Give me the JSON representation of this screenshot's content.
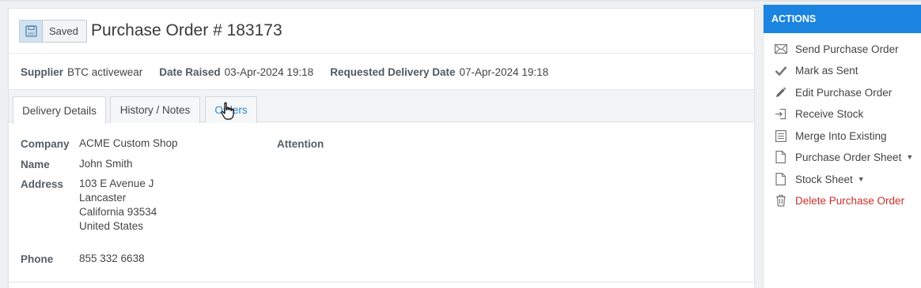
{
  "header": {
    "saved_label": "Saved",
    "title": "Purchase Order # 183173"
  },
  "meta": {
    "supplier_label": "Supplier",
    "supplier_value": "BTC activewear",
    "date_raised_label": "Date Raised",
    "date_raised_value": "03-Apr-2024 19:18",
    "requested_label": "Requested Delivery Date",
    "requested_value": "07-Apr-2024 19:18"
  },
  "tabs": [
    {
      "label": "Delivery Details",
      "active": true
    },
    {
      "label": "History / Notes",
      "active": false
    },
    {
      "label": "Orders",
      "active": false
    }
  ],
  "delivery": {
    "company_label": "Company",
    "company_value": "ACME Custom Shop",
    "attention_label": "Attention",
    "name_label": "Name",
    "name_value": "John Smith",
    "address_label": "Address",
    "address_lines": [
      "103 E Avenue J",
      "Lancaster",
      "California 93534",
      "United States"
    ],
    "phone_label": "Phone",
    "phone_value": "855 332 6638"
  },
  "actions": {
    "title": "ACTIONS",
    "items": [
      {
        "label": "Send Purchase Order",
        "icon": "envelope-icon"
      },
      {
        "label": "Mark as Sent",
        "icon": "check-icon"
      },
      {
        "label": "Edit Purchase Order",
        "icon": "pencil-icon"
      },
      {
        "label": "Receive Stock",
        "icon": "receive-icon"
      },
      {
        "label": "Merge Into Existing",
        "icon": "list-icon"
      },
      {
        "label": "Purchase Order Sheet",
        "icon": "document-icon",
        "dropdown": true
      },
      {
        "label": "Stock Sheet",
        "icon": "document-icon",
        "dropdown": true
      },
      {
        "label": "Delete Purchase Order",
        "icon": "trash-icon",
        "danger": true
      }
    ]
  },
  "colors": {
    "accent": "#1b84e0",
    "link": "#2a86d6",
    "danger": "#c9302c"
  }
}
